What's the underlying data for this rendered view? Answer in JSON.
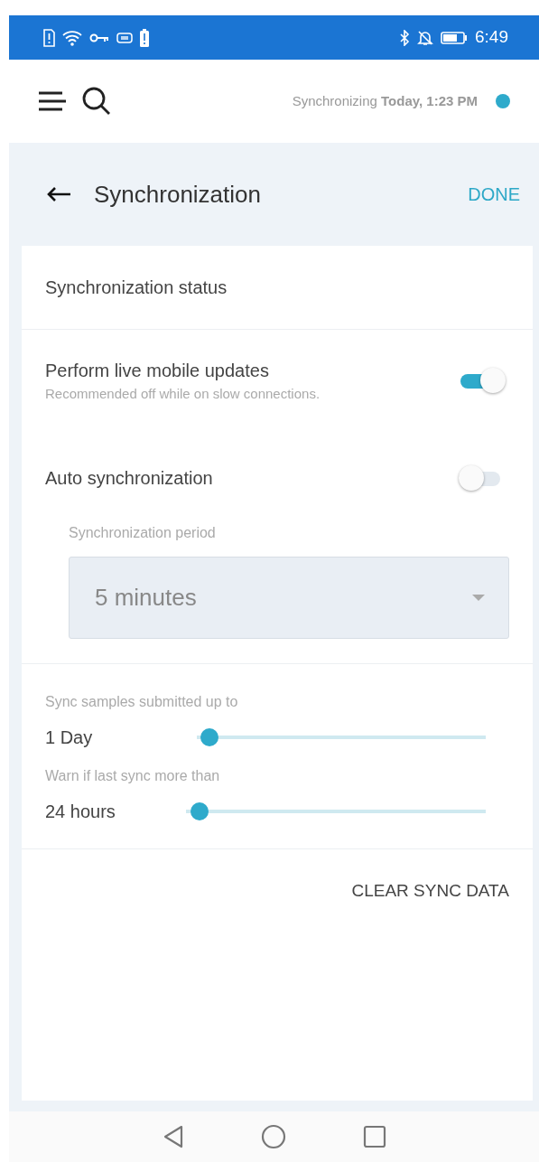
{
  "status_bar": {
    "time": "6:49"
  },
  "app_bar": {
    "sync_label": "Synchronizing",
    "sync_time": "Today, 1:23 PM"
  },
  "header": {
    "title": "Synchronization",
    "action": "DONE"
  },
  "sections": [
    {
      "kind": "heading",
      "text": "Synchronization status"
    },
    {
      "kind": "toggles",
      "items": [
        {
          "label": "Perform live mobile updates",
          "hint": "Recommended off while on slow connections.",
          "on": true
        },
        {
          "label": "Auto synchronization",
          "on": false
        }
      ],
      "select": {
        "label": "Synchronization period",
        "value": "5 minutes",
        "disabled": true
      }
    },
    {
      "kind": "sliders",
      "items": [
        {
          "label": "Sync samples submitted up to",
          "reading": "1 Day",
          "level": 0.02
        },
        {
          "label": "Warn if last sync more than",
          "reading": "24 hours",
          "level": 0.02
        }
      ]
    },
    {
      "kind": "action",
      "text": "CLEAR SYNC DATA"
    }
  ]
}
